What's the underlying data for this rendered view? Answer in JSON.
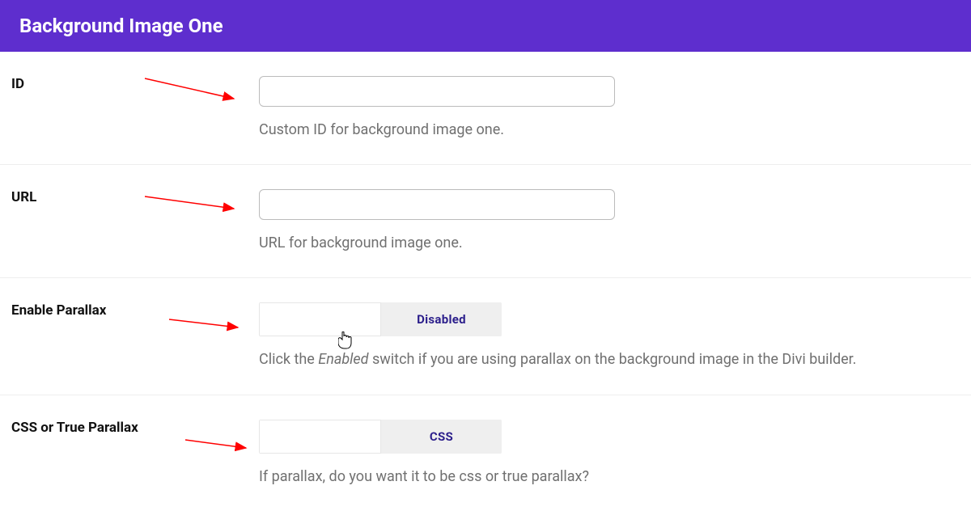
{
  "header": {
    "title": "Background Image One"
  },
  "rows": {
    "id": {
      "label": "ID",
      "value": "",
      "description": "Custom ID for background image one."
    },
    "url": {
      "label": "URL",
      "value": "",
      "description": "URL for background image one."
    },
    "parallax": {
      "label": "Enable Parallax",
      "toggle_active": "",
      "toggle_inactive": "Disabled",
      "description_prefix": "Click the ",
      "description_em": "Enabled",
      "description_suffix": " switch if you are using parallax on the background image in the Divi builder."
    },
    "css_true": {
      "label": "CSS or True Parallax",
      "toggle_active": "",
      "toggle_inactive": "CSS",
      "description": "If parallax, do you want it to be css or true parallax?"
    }
  }
}
